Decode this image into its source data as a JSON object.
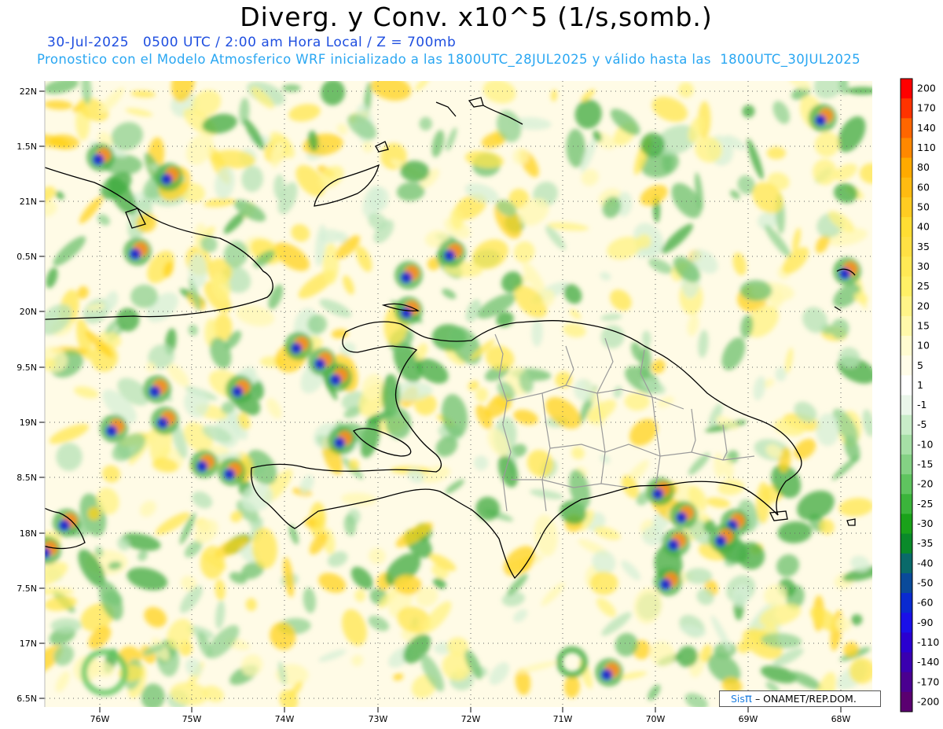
{
  "header": {
    "title": "Diverg. y Conv. x10^5 (1/s,somb.)",
    "subtitle_date": "30-Jul-2025   0500 UTC / 2:00 am Hora Local / Z = 700mb",
    "subtitle_model": "Pronostico con el Modelo Atmosferico WRF inicializado a las 1800UTC_28JUL2025 y válido hasta las  1800UTC_30JUL2025"
  },
  "map": {
    "lat_labels": [
      "22N",
      "1.5N",
      "21N",
      "0.5N",
      "20N",
      "9.5N",
      "19N",
      "8.5N",
      "18N",
      "7.5N",
      "17N",
      "6.5N"
    ],
    "lon_labels": [
      "76W",
      "75W",
      "74W",
      "73W",
      "72W",
      "71W",
      "70W",
      "69W",
      "68W"
    ],
    "grid": "dotted"
  },
  "colorbar": {
    "labels": [
      "200",
      "170",
      "140",
      "110",
      "80",
      "60",
      "50",
      "40",
      "35",
      "30",
      "25",
      "20",
      "15",
      "10",
      "5",
      "1",
      "-1",
      "-5",
      "-10",
      "-15",
      "-20",
      "-25",
      "-30",
      "-35",
      "-40",
      "-50",
      "-60",
      "-90",
      "-110",
      "-140",
      "-170",
      "-200"
    ],
    "colors": [
      "#ff0000",
      "#ff3300",
      "#ff6600",
      "#ff8800",
      "#ffaa00",
      "#ffbb11",
      "#ffcc22",
      "#ffdd33",
      "#ffe044",
      "#ffe955",
      "#fff066",
      "#fff488",
      "#fff8aa",
      "#fffbd0",
      "#fffce8",
      "#ffffff",
      "#eaf6ea",
      "#c8ecc8",
      "#a6dfa6",
      "#84d184",
      "#5fc45f",
      "#3bb43b",
      "#1aa21a",
      "#0a8a2a",
      "#0a6a6a",
      "#0a4a9a",
      "#0a2ad0",
      "#1a10e8",
      "#2a00d0",
      "#3a00b0",
      "#4a0090",
      "#5a0070"
    ]
  },
  "footer": {
    "credit_sis": "Sis",
    "credit_pi": "π",
    "credit_org": "– ONAMET/REP.DOM."
  }
}
